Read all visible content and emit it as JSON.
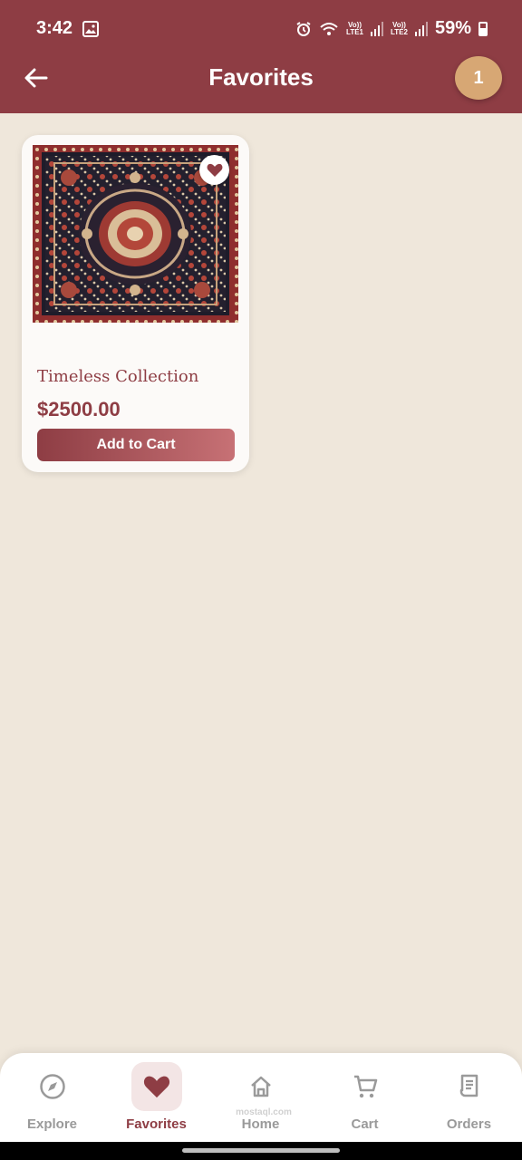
{
  "status_bar": {
    "time": "3:42",
    "lte1": "LTE1",
    "lte2": "LTE2",
    "volte": "Vo))",
    "battery": "59%"
  },
  "header": {
    "title": "Favorites",
    "badge_count": "1"
  },
  "favorites": [
    {
      "name": "Timeless Collection",
      "price": "$2500.00",
      "button_label": "Add to Cart",
      "favorited": true
    }
  ],
  "bottom_nav": {
    "items": [
      {
        "label": "Explore",
        "icon": "compass-icon",
        "active": false
      },
      {
        "label": "Favorites",
        "icon": "heart-icon",
        "active": true
      },
      {
        "label": "Home",
        "icon": "home-icon",
        "active": false
      },
      {
        "label": "Cart",
        "icon": "cart-icon",
        "active": false
      },
      {
        "label": "Orders",
        "icon": "receipt-icon",
        "active": false
      }
    ],
    "watermark": "mostaql.com"
  },
  "colors": {
    "brand": "#8E3D44",
    "background": "#EFE7DB",
    "badge": "#D7A774",
    "inactive": "#9A9A9A"
  }
}
